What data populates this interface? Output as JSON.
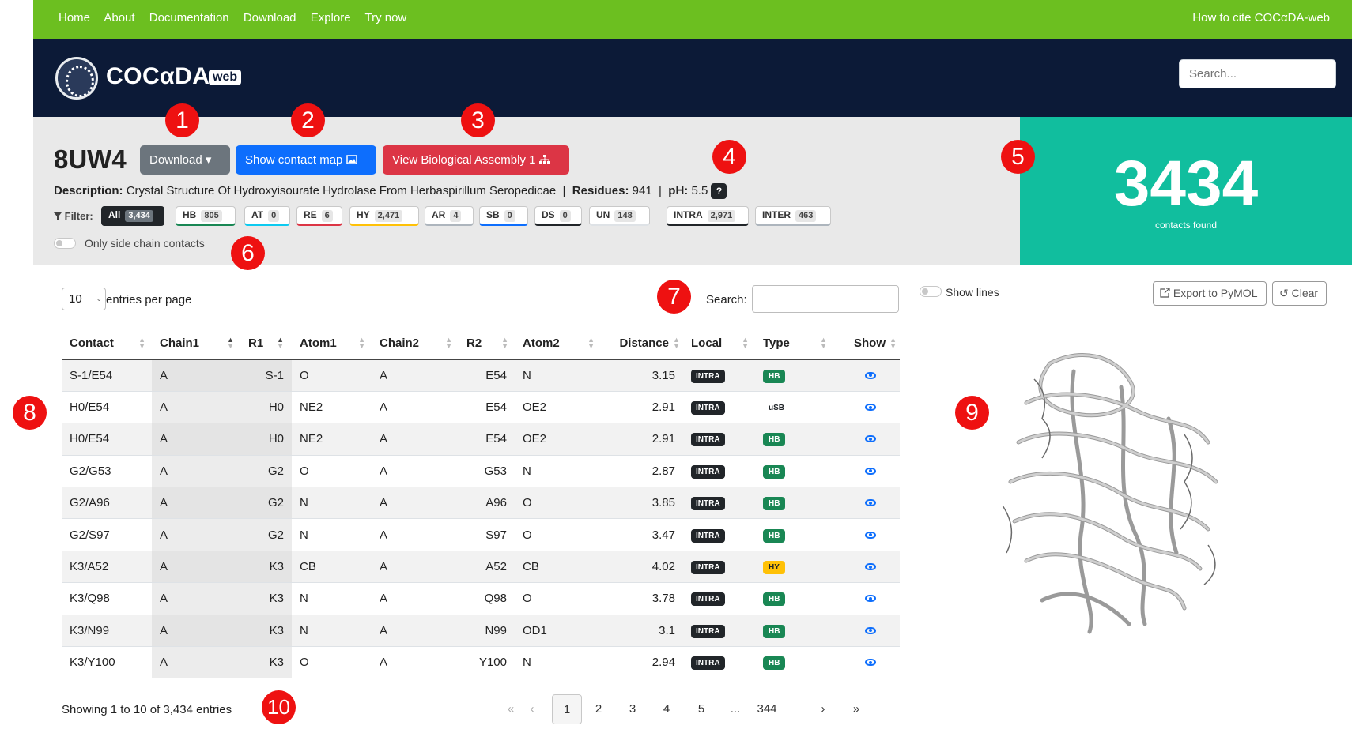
{
  "topnav": {
    "links": [
      "Home",
      "About",
      "Documentation",
      "Download",
      "Explore",
      "Try now"
    ],
    "cite": "How to cite COCαDA-web"
  },
  "brand": {
    "name": "COCαDA",
    "tag": "web",
    "search_placeholder": "Search..."
  },
  "entry": {
    "pdb_id": "8UW4",
    "download_label": "Download ▾",
    "contact_map_label": "Show contact map",
    "assembly_label": "View Biological Assembly 1",
    "description_label": "Description:",
    "description": "Crystal Structure Of Hydroxyisourate Hydrolase From Herbaspirillum Seropedicae",
    "residues_label": "Residues:",
    "residues": "941",
    "ph_label": "pH:",
    "ph": "5.5",
    "help": "?"
  },
  "filters": {
    "label": "Filter:",
    "chips": [
      {
        "label": "All",
        "count": "3,434",
        "color": "#212529"
      },
      {
        "label": "HB",
        "count": "805",
        "color": "#198754"
      },
      {
        "label": "AT",
        "count": "0",
        "color": "#0dcaf0"
      },
      {
        "label": "RE",
        "count": "6",
        "color": "#dc3545"
      },
      {
        "label": "HY",
        "count": "2,471",
        "color": "#ffc107"
      },
      {
        "label": "AR",
        "count": "4",
        "color": "#adb5bd"
      },
      {
        "label": "SB",
        "count": "0",
        "color": "#0d6efd"
      },
      {
        "label": "DS",
        "count": "0",
        "color": "#212529"
      },
      {
        "label": "UN",
        "count": "148",
        "color": "#dee2e6"
      },
      {
        "label": "INTRA",
        "count": "2,971",
        "color": "#212529"
      },
      {
        "label": "INTER",
        "count": "463",
        "color": "#adb5bd"
      }
    ],
    "side_chain_label": "Only side chain contacts"
  },
  "summary": {
    "count": "3434",
    "caption": "contacts found",
    "color": "#11be9e"
  },
  "table_controls": {
    "entries_value": "10",
    "entries_label": "entries per page",
    "search_label": "Search:"
  },
  "table": {
    "headers": [
      "Contact",
      "Chain1",
      "R1",
      "Atom1",
      "Chain2",
      "R2",
      "Atom2",
      "Distance",
      "Local",
      "Type",
      "Show"
    ],
    "rows": [
      [
        "S-1/E54",
        "A",
        "S-1",
        "O",
        "A",
        "E54",
        "N",
        "3.15",
        "INTRA",
        "HB"
      ],
      [
        "H0/E54",
        "A",
        "H0",
        "NE2",
        "A",
        "E54",
        "OE2",
        "2.91",
        "INTRA",
        "uSB"
      ],
      [
        "H0/E54",
        "A",
        "H0",
        "NE2",
        "A",
        "E54",
        "OE2",
        "2.91",
        "INTRA",
        "HB"
      ],
      [
        "G2/G53",
        "A",
        "G2",
        "O",
        "A",
        "G53",
        "N",
        "2.87",
        "INTRA",
        "HB"
      ],
      [
        "G2/A96",
        "A",
        "G2",
        "N",
        "A",
        "A96",
        "O",
        "3.85",
        "INTRA",
        "HB"
      ],
      [
        "G2/S97",
        "A",
        "G2",
        "N",
        "A",
        "S97",
        "O",
        "3.47",
        "INTRA",
        "HB"
      ],
      [
        "K3/A52",
        "A",
        "K3",
        "CB",
        "A",
        "A52",
        "CB",
        "4.02",
        "INTRA",
        "HY"
      ],
      [
        "K3/Q98",
        "A",
        "K3",
        "N",
        "A",
        "Q98",
        "O",
        "3.78",
        "INTRA",
        "HB"
      ],
      [
        "K3/N99",
        "A",
        "K3",
        "N",
        "A",
        "N99",
        "OD1",
        "3.1",
        "INTRA",
        "HB"
      ],
      [
        "K3/Y100",
        "A",
        "K3",
        "O",
        "A",
        "Y100",
        "N",
        "2.94",
        "INTRA",
        "HB"
      ]
    ],
    "type_colors": {
      "HB": "#198754",
      "HY": "#ffc107",
      "uSB": "#ffffff"
    }
  },
  "footer": {
    "showing": "Showing 1 to 10 of 3,434 entries",
    "pages": [
      "«",
      "‹",
      "1",
      "2",
      "3",
      "4",
      "5",
      "...",
      "344",
      "›",
      "»"
    ]
  },
  "viewer": {
    "show_lines_label": "Show lines",
    "export_label": "Export to PyMOL",
    "clear_label": "Clear"
  },
  "annotations": [
    "1",
    "2",
    "3",
    "4",
    "5",
    "6",
    "7",
    "8",
    "9",
    "10"
  ]
}
